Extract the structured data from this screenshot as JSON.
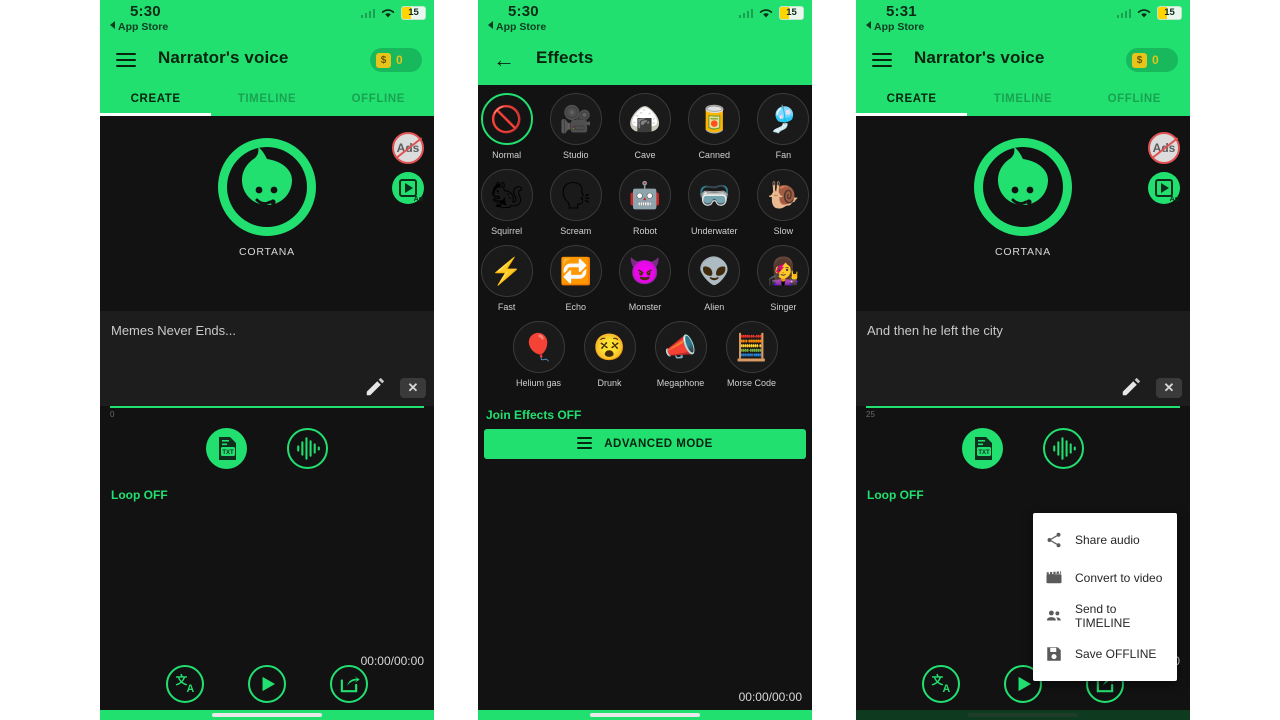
{
  "panels": [
    {
      "id": "create-panel",
      "status": {
        "time": "5:30",
        "back_app": "App Store",
        "battery": "15"
      },
      "appbar": {
        "title": "Narrator's voice",
        "coins": "0",
        "menu_icon": "hamburger-icon"
      },
      "tabs": [
        {
          "label": "CREATE",
          "active": true
        },
        {
          "label": "TIMELINE",
          "active": false
        },
        {
          "label": "OFFLINE",
          "active": false
        }
      ],
      "avatar": {
        "name": "CORTANA"
      },
      "badges": {
        "no_ads": "Ads",
        "ad_video": "Ad"
      },
      "text_input": {
        "value": "Memes Never Ends...",
        "char_count": "0"
      },
      "actions": {
        "loop": "Loop OFF",
        "timer": "00:00/00:00"
      }
    },
    {
      "id": "effects-panel",
      "status": {
        "time": "5:30",
        "back_app": "App Store",
        "battery": "15"
      },
      "appbar": {
        "title": "Effects",
        "back_icon": "back-arrow-icon"
      },
      "effects": [
        {
          "label": "Normal",
          "icon": "prohibition-icon",
          "glyph": "🚫",
          "selected": true
        },
        {
          "label": "Studio",
          "icon": "movie-camera-icon",
          "glyph": "🎥",
          "selected": false
        },
        {
          "label": "Cave",
          "icon": "rice-ball-icon",
          "glyph": "🍙",
          "selected": false
        },
        {
          "label": "Canned",
          "icon": "can-icon",
          "glyph": "🥫",
          "selected": false
        },
        {
          "label": "Fan",
          "icon": "fan-icon",
          "glyph": "🎐",
          "selected": false
        },
        {
          "label": "Squirrel",
          "icon": "squirrel-icon",
          "glyph": "🐿",
          "selected": false
        },
        {
          "label": "Scream",
          "icon": "shouting-face-icon",
          "glyph": "🗣",
          "selected": false
        },
        {
          "label": "Robot",
          "icon": "robot-icon",
          "glyph": "🤖",
          "selected": false
        },
        {
          "label": "Underwater",
          "icon": "goggles-icon",
          "glyph": "🥽",
          "selected": false
        },
        {
          "label": "Slow",
          "icon": "snail-icon",
          "glyph": "🐌",
          "selected": false
        },
        {
          "label": "Fast",
          "icon": "lightning-bolt-icon",
          "glyph": "⚡",
          "selected": false
        },
        {
          "label": "Echo",
          "icon": "repeat-icon",
          "glyph": "🔁",
          "selected": false
        },
        {
          "label": "Monster",
          "icon": "devil-icon",
          "glyph": "😈",
          "selected": false
        },
        {
          "label": "Alien",
          "icon": "alien-icon",
          "glyph": "👽",
          "selected": false
        },
        {
          "label": "Singer",
          "icon": "singer-icon",
          "glyph": "👩‍🎤",
          "selected": false
        },
        {
          "label": "Helium gas",
          "icon": "balloon-icon",
          "glyph": "🎈",
          "selected": false
        },
        {
          "label": "Drunk",
          "icon": "dizzy-face-icon",
          "glyph": "😵",
          "selected": false
        },
        {
          "label": "Megaphone",
          "icon": "megaphone-icon",
          "glyph": "📣",
          "selected": false
        },
        {
          "label": "Morse Code",
          "icon": "abacus-icon",
          "glyph": "🧮",
          "selected": false
        }
      ],
      "join_effects": "Join Effects OFF",
      "advanced_button": "ADVANCED MODE",
      "timer": "00:00/00:00"
    },
    {
      "id": "create-panel-menu-open",
      "status": {
        "time": "5:31",
        "back_app": "App Store",
        "battery": "15"
      },
      "appbar": {
        "title": "Narrator's voice",
        "coins": "0",
        "menu_icon": "hamburger-icon"
      },
      "tabs": [
        {
          "label": "CREATE",
          "active": true
        },
        {
          "label": "TIMELINE",
          "active": false
        },
        {
          "label": "OFFLINE",
          "active": false
        }
      ],
      "avatar": {
        "name": "CORTANA"
      },
      "badges": {
        "no_ads": "Ads",
        "ad_video": "Ad"
      },
      "text_input": {
        "value": "And then he left the city",
        "char_count": "25"
      },
      "actions": {
        "loop": "Loop OFF",
        "timer": "00:00/00:00"
      },
      "menu": [
        {
          "label": "Share audio",
          "icon": "share-icon"
        },
        {
          "label": "Convert to video",
          "icon": "movie-clapper-icon"
        },
        {
          "label": "Send to TIMELINE",
          "icon": "people-icon"
        },
        {
          "label": "Save OFFLINE",
          "icon": "floppy-disk-icon"
        }
      ]
    }
  ],
  "colors": {
    "brand_green": "#22E070",
    "dark_bg": "#121212",
    "input_bg": "#1d1d1d",
    "battery_yellow": "#ffd400"
  }
}
